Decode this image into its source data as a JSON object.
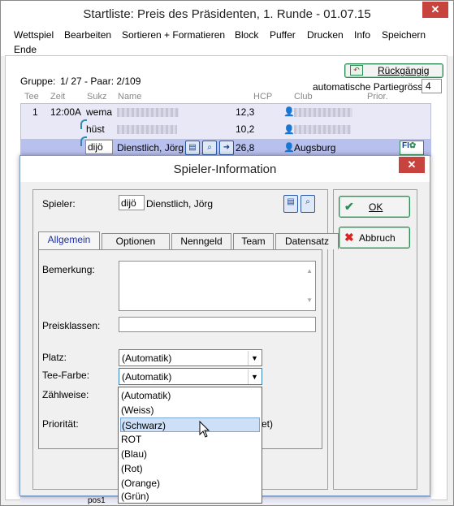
{
  "window": {
    "title": "Startliste: Preis des Präsidenten, 1. Runde - 01.07.15",
    "close_label": "✕"
  },
  "menu": [
    "Wettspiel",
    "Bearbeiten",
    "Sortieren + Formatieren",
    "Block",
    "Puffer",
    "Drucken",
    "Info",
    "Speichern",
    "Ende"
  ],
  "header": {
    "gruppe_label": "Gruppe:",
    "gruppe_value": "1/ 27 - Paar: 2/109",
    "undo_label": "Rückgängig",
    "auto_label": "automatische Partiegrösse:",
    "auto_value": "4",
    "columns": [
      "Tee",
      "Zeit",
      "Sukz",
      "Name",
      "HCP",
      "Club",
      "Prior."
    ]
  },
  "rows": [
    {
      "tee": "1",
      "zeit": "12:00A",
      "sukz": "wema",
      "name": "",
      "hcp": "12,3",
      "club": ""
    },
    {
      "tee": "",
      "zeit": "",
      "sukz": "hüst",
      "name": "",
      "hcp": "10,2",
      "club": ""
    },
    {
      "tee": "",
      "zeit": "",
      "sukz": "dijö",
      "name": "Dienstlich, Jörg",
      "hcp": "26,8",
      "club": "Augsburg"
    }
  ],
  "bottom_row_sukz": "pos1",
  "dialog": {
    "title": "Spieler-Information",
    "close_label": "✕",
    "spieler_label": "Spieler:",
    "spieler_code": "dijö",
    "spieler_name": "Dienstlich, Jörg",
    "ok_label": "OK",
    "abbruch_label": "Abbruch",
    "tabs": [
      "Allgemein",
      "Optionen",
      "Nenngeld",
      "Team",
      "Datensatz"
    ],
    "bemerkung_label": "Bemerkung:",
    "preisklassen_label": "Preisklassen:",
    "platz_label": "Platz:",
    "platz_value": "(Automatik)",
    "teefarbe_label": "Tee-Farbe:",
    "teefarbe_value": "(Automatik)",
    "zaehlweise_label": "Zählweise:",
    "prioritaet_label": "Priorität:",
    "prioritaet_partial": "et)"
  },
  "dropdown_options": [
    "(Automatik)",
    "(Weiss)",
    "(Schwarz)",
    "ROT",
    "(Blau)",
    "(Rot)",
    "(Orange)",
    "(Grün)"
  ],
  "dropdown_selected_index": 2
}
